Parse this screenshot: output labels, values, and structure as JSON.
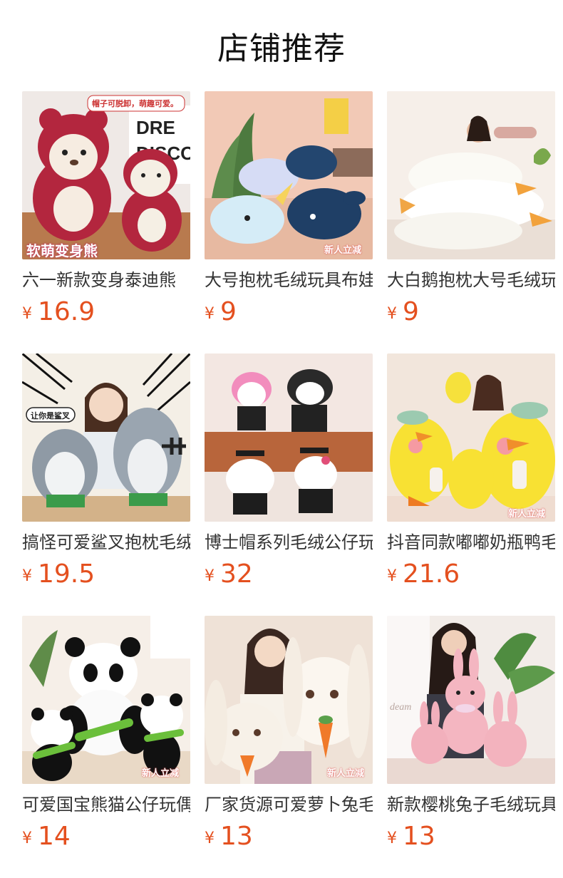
{
  "section": {
    "title": "店铺推荐"
  },
  "currency_symbol": "¥",
  "products": [
    {
      "name": "六一新款变身泰迪熊",
      "price": "16.9",
      "image": "teddy-bear-strawberry-costume",
      "badge": "软萌变身熊",
      "bubble": "帽子可脱卸，萌趣可爱。"
    },
    {
      "name": "大号抱枕毛绒玩具布娃娃",
      "price": "9",
      "image": "narwhal-whale-plush",
      "badge": "新人立减"
    },
    {
      "name": "大白鹅抱枕大号毛绒玩具",
      "price": "9",
      "image": "white-goose-plush"
    },
    {
      "name": "搞怪可爱鲨叉抱枕毛绒",
      "price": "19.5",
      "image": "shark-fork-plush",
      "bubble": "让你是鲨叉"
    },
    {
      "name": "博士帽系列毛绒公仔玩具",
      "price": "32",
      "image": "graduation-cap-plush"
    },
    {
      "name": "抖音同款嘟嘟奶瓶鸭毛绒",
      "price": "21.6",
      "image": "yellow-duck-bottle-plush",
      "badge": "新人立减"
    },
    {
      "name": "可爱国宝熊猫公仔玩偶",
      "price": "14",
      "image": "panda-plush",
      "badge": "新人立减"
    },
    {
      "name": "厂家货源可爱萝卜兔毛绒",
      "price": "13",
      "image": "carrot-rabbit-plush",
      "badge": "新人立减"
    },
    {
      "name": "新款樱桃兔子毛绒玩具",
      "price": "13",
      "image": "cherry-rabbit-plush"
    }
  ]
}
